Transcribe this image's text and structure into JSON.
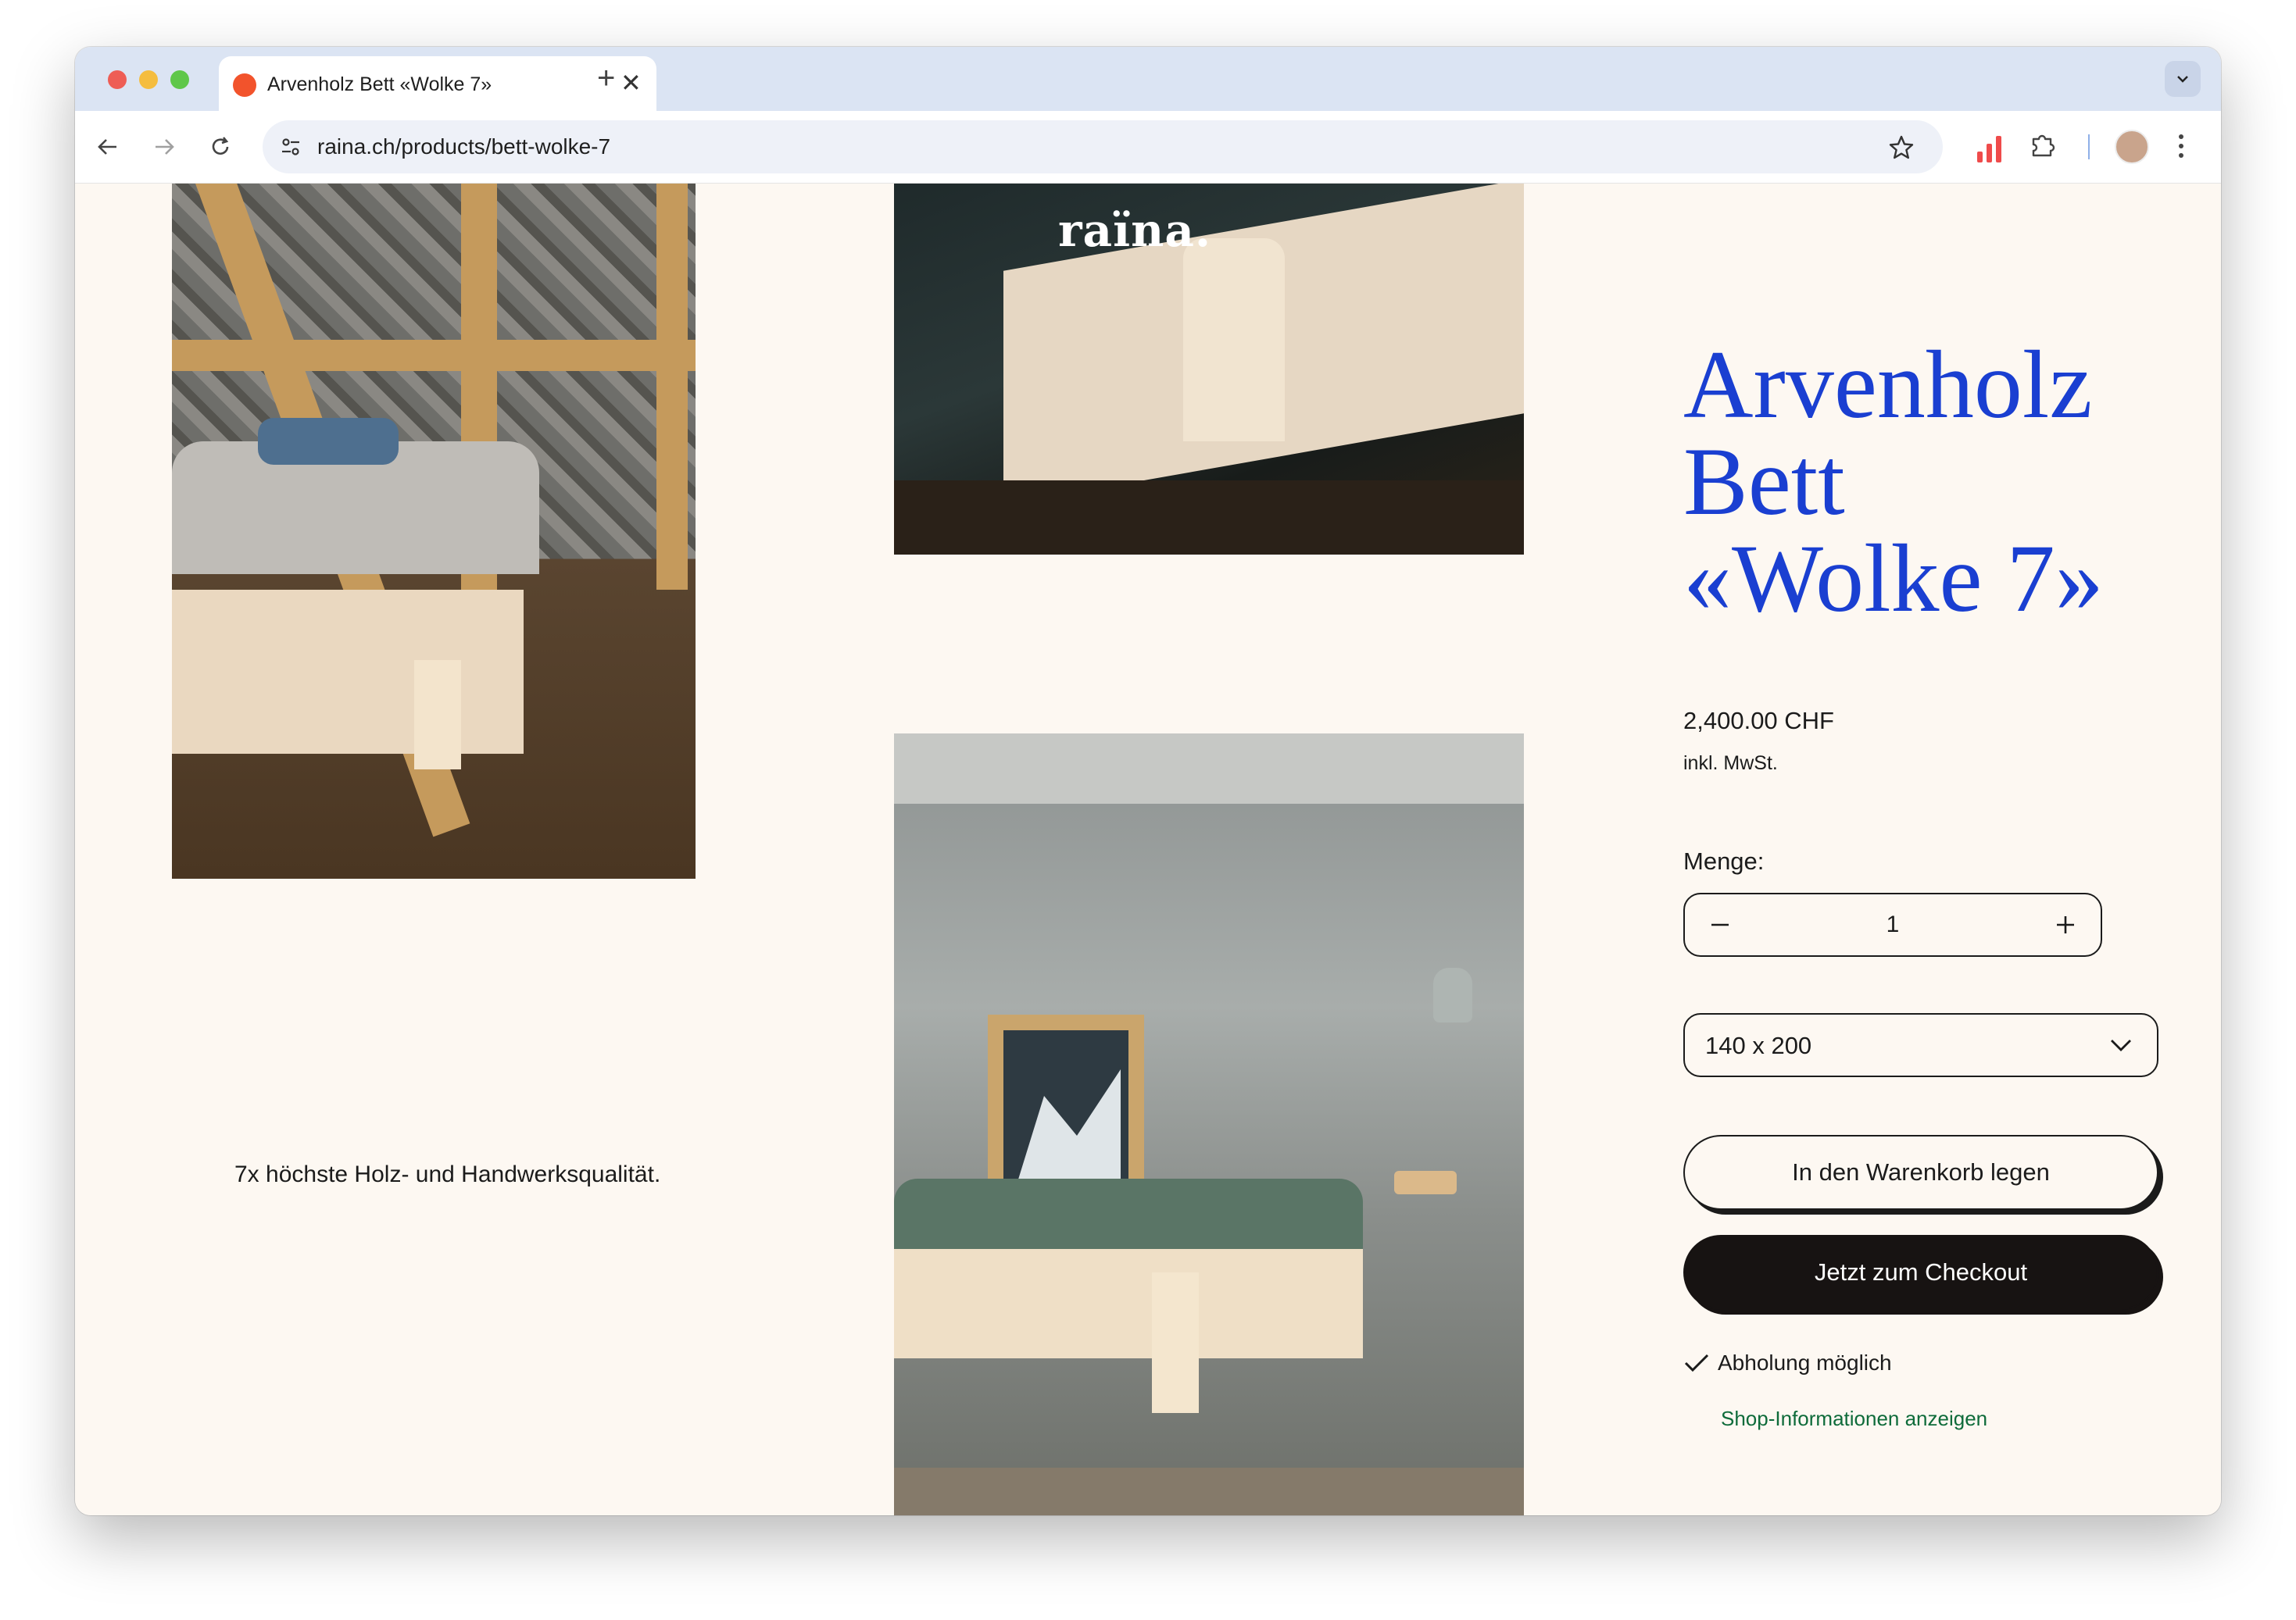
{
  "browser": {
    "tab_title": "Arvenholz Bett «Wolke 7»",
    "tab_close": "✕",
    "new_tab": "+",
    "url": "raina.ch/products/bett-wolke-7"
  },
  "page": {
    "logo": "raïna.",
    "tagline": "7x höchste Holz- und Handwerksqualität.",
    "product_title": "Arvenholz Bett «Wolke 7»",
    "price": "2,400.00 CHF",
    "tax_note": "inkl. MwSt.",
    "quantity_label": "Menge:",
    "quantity_value": "1",
    "size_value": "140 x 200",
    "add_to_cart": "In den Warenkorb legen",
    "checkout": "Jetzt zum Checkout",
    "pickup": "Abholung möglich",
    "shop_info_link": "Shop-Informationen anzeigen"
  },
  "colors": {
    "title_blue": "#1a3fd1",
    "link_green": "#0e6b3a",
    "page_bg": "#fdf8f2",
    "checkout_bg": "#171312"
  }
}
